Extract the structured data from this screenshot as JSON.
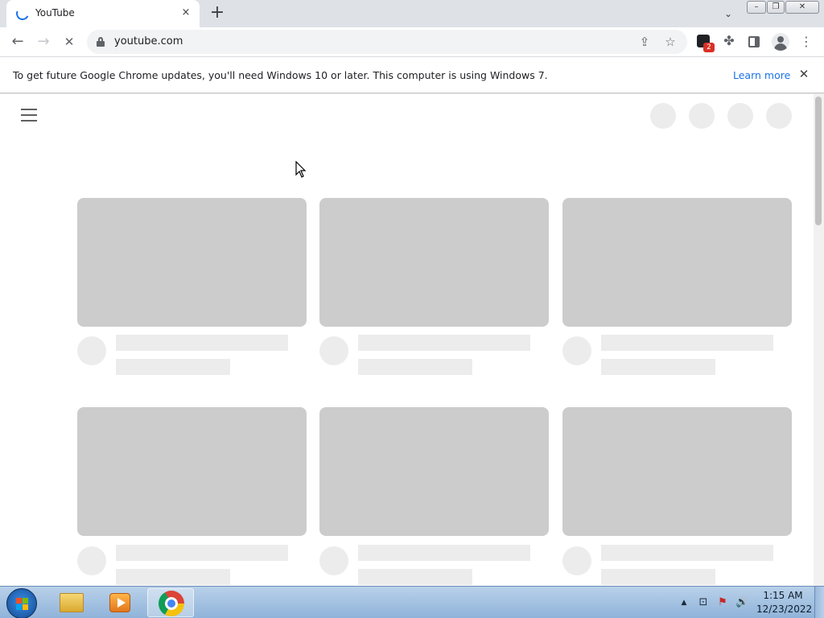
{
  "browser": {
    "tab": {
      "title": "YouTube",
      "close_icon": "×"
    },
    "new_tab_icon": "+",
    "tab_search_icon": "⌄",
    "window_controls": {
      "minimize": "–",
      "maximize": "❐",
      "close": "✕"
    },
    "toolbar": {
      "back_icon": "←",
      "forward_icon": "→",
      "reload_icon": "✕",
      "url": "youtube.com",
      "share_icon": "⇪",
      "bookmark_icon": "☆",
      "extension_badge": "2",
      "puzzle_icon": "✤",
      "menu_icon": "⋮"
    },
    "infobar": {
      "message": "To get future Google Chrome updates, you'll need Windows 10 or later. This computer is using Windows 7.",
      "link": "Learn more",
      "close_icon": "✕"
    }
  },
  "page": {
    "loading_skeleton": true,
    "header_placeholder_count": 4,
    "card_rows_visible": 2,
    "cards_per_row": 3
  },
  "taskbar": {
    "apps": [
      "windows-explorer",
      "windows-media-player",
      "google-chrome"
    ],
    "active_app": "google-chrome",
    "tray": {
      "arrow": "▲",
      "network": "⊡",
      "flag": "⚑",
      "volume": "🔊"
    },
    "clock": {
      "time": "1:15 AM",
      "date": "12/23/2022"
    }
  },
  "colors": {
    "skeleton_thumb": "#cccccc",
    "skeleton_light": "#ececec",
    "link": "#1a73e8",
    "tabstrip": "#dee1e6"
  }
}
